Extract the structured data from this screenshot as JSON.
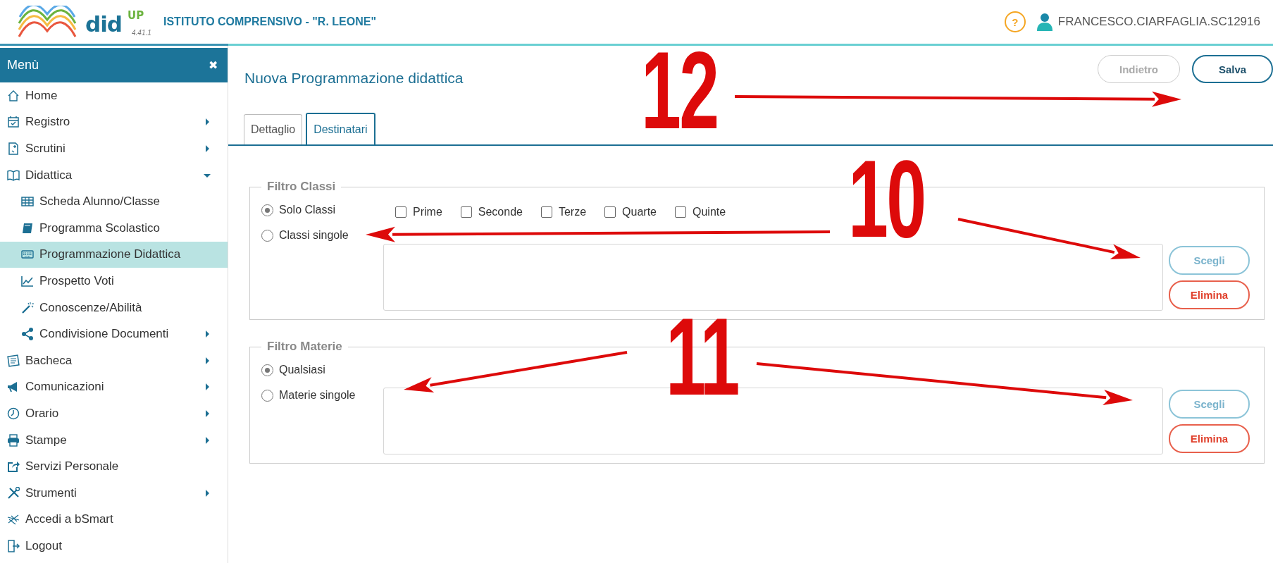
{
  "header": {
    "brand": "did",
    "brand_sup": "UP",
    "version": "4.41.1",
    "school": "ISTITUTO COMPRENSIVO - \"R. LEONE\"",
    "help": "?",
    "user": "FRANCESCO.CIARFAGLIA.SC12916"
  },
  "sidebar": {
    "title": "Menù",
    "close": "✖",
    "items": [
      {
        "label": "Home",
        "kind": "link",
        "selected": false
      },
      {
        "label": "Registro",
        "kind": "folder",
        "expanded": false,
        "selected": false
      },
      {
        "label": "Scrutini",
        "kind": "folder",
        "expanded": false,
        "selected": false
      },
      {
        "label": "Didattica",
        "kind": "folder",
        "expanded": true,
        "selected": false,
        "children": [
          {
            "label": "Scheda Alunno/Classe",
            "kind": "link",
            "selected": false
          },
          {
            "label": "Programma Scolastico",
            "kind": "link",
            "selected": false
          },
          {
            "label": "Programmazione Didattica",
            "kind": "link",
            "selected": true
          },
          {
            "label": "Prospetto Voti",
            "kind": "link",
            "selected": false
          },
          {
            "label": "Conoscenze/Abilità",
            "kind": "link",
            "selected": false
          },
          {
            "label": "Condivisione Documenti",
            "kind": "folder",
            "expanded": false,
            "selected": false
          }
        ]
      },
      {
        "label": "Bacheca",
        "kind": "folder",
        "expanded": false,
        "selected": false
      },
      {
        "label": "Comunicazioni",
        "kind": "folder",
        "expanded": false,
        "selected": false
      },
      {
        "label": "Orario",
        "kind": "folder",
        "expanded": false,
        "selected": false
      },
      {
        "label": "Stampe",
        "kind": "folder",
        "expanded": false,
        "selected": false
      },
      {
        "label": "Servizi Personale",
        "kind": "link",
        "selected": false
      },
      {
        "label": "Strumenti",
        "kind": "folder",
        "expanded": false,
        "selected": false
      },
      {
        "label": "Accedi a bSmart",
        "kind": "link",
        "selected": false
      },
      {
        "label": "Logout",
        "kind": "link",
        "selected": false
      }
    ]
  },
  "page": {
    "title": "Nuova Programmazione didattica",
    "buttons": [
      {
        "label": "Indietro",
        "disabled": true
      },
      {
        "label": "Salva",
        "disabled": false
      }
    ],
    "tabs": [
      {
        "label": "Dettaglio",
        "selected": false
      },
      {
        "label": "Destinatari",
        "selected": true
      }
    ],
    "filters": [
      {
        "legend": "Filtro Classi",
        "radios": [
          {
            "label": "Solo Classi",
            "selected": true
          },
          {
            "label": "Classi singole",
            "selected": false
          }
        ],
        "checkboxes": [
          {
            "label": "Prime",
            "checked": false
          },
          {
            "label": "Seconde",
            "checked": false
          },
          {
            "label": "Terze",
            "checked": false
          },
          {
            "label": "Quarte",
            "checked": false
          },
          {
            "label": "Quinte",
            "checked": false
          }
        ],
        "buttons": [
          {
            "label": "Scegli",
            "kind": "choose"
          },
          {
            "label": "Elimina",
            "kind": "delete"
          }
        ]
      },
      {
        "legend": "Filtro Materie",
        "radios": [
          {
            "label": "Qualsiasi",
            "selected": true
          },
          {
            "label": "Materie singole",
            "selected": false
          }
        ],
        "buttons": [
          {
            "label": "Scegli",
            "kind": "choose"
          },
          {
            "label": "Elimina",
            "kind": "delete"
          }
        ]
      }
    ]
  },
  "annotations": [
    {
      "label": "12"
    },
    {
      "label": "10"
    },
    {
      "label": "11"
    }
  ]
}
